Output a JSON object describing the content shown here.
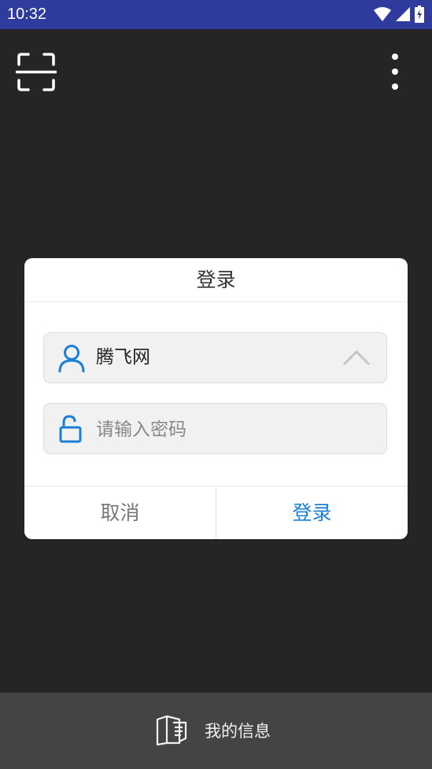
{
  "status_bar": {
    "time": "10:32"
  },
  "toolbar": {
    "scan_icon": "scan-icon",
    "menu_icon": "more-vertical-icon"
  },
  "dialog": {
    "title": "登录",
    "username": {
      "value": "腾飞网",
      "icon": "user-icon",
      "dropdown_icon": "chevron-up-icon"
    },
    "password": {
      "placeholder": "请输入密码",
      "icon": "unlock-icon"
    },
    "cancel_label": "取消",
    "confirm_label": "登录"
  },
  "bottom_nav": {
    "label": "我的信息",
    "icon": "info-book-icon"
  },
  "colors": {
    "status_bar": "#2f3c9e",
    "background": "#252525",
    "accent": "#1a7fd6",
    "bottom_bar": "#444444"
  }
}
